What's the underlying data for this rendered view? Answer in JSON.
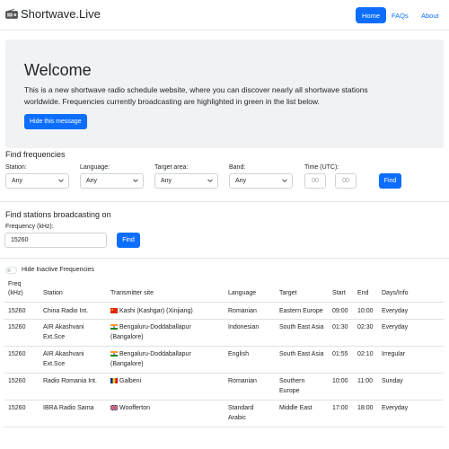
{
  "nav": {
    "brand": "Shortwave.Live",
    "home": "Home",
    "faqs": "FAQs",
    "about": "About"
  },
  "welcome": {
    "title": "Welcome",
    "text": "This is a new shortwave radio schedule website, where you can discover nearly all shortwave stations worldwide. Frequencies currently broadcasting are highlighted in green in the list below.",
    "button": "Hide this message"
  },
  "find_frequencies": {
    "title": "Find frequencies",
    "station_label": "Station:",
    "station_value": "Any",
    "language_label": "Language:",
    "language_value": "Any",
    "target_label": "Target area:",
    "target_value": "Any",
    "band_label": "Band:",
    "band_value": "Any",
    "time_label": "Time (UTC):",
    "time_hour_placeholder": "00",
    "time_min_placeholder": "00",
    "find_button": "Find"
  },
  "find_stations": {
    "title": "Find stations broadcasting on",
    "freq_label": "Frequency (kHz):",
    "freq_value": "15260",
    "find_button": "Find"
  },
  "toggle": {
    "label": "Hide Inactive Frequencies",
    "on": false
  },
  "table": {
    "headers": {
      "freq": "Freq",
      "freq_unit": "(kHz)",
      "station": "Station",
      "site": "Transmitter site",
      "language": "Language",
      "target": "Target",
      "start": "Start",
      "end": "End",
      "days": "Days/Info"
    },
    "rows": [
      {
        "freq": "15260",
        "station": [
          "China Radio Int."
        ],
        "flag": "china-flag-icon",
        "site": [
          "Kashi (Kashgar) (Xinjiang)"
        ],
        "language": [
          "Romanian"
        ],
        "target": [
          "Eastern Europe"
        ],
        "start": "09:00",
        "end": "10:00",
        "days": "Everyday"
      },
      {
        "freq": "15260",
        "station": [
          "AIR Akashvani",
          "Ext.Sce"
        ],
        "flag": "india-flag-icon",
        "site": [
          "Bengaluru-Doddaballapur",
          "(Bangalore)"
        ],
        "language": [
          "Indonesian"
        ],
        "target": [
          "South East Asia"
        ],
        "start": "01:30",
        "end": "02:30",
        "days": "Everyday"
      },
      {
        "freq": "15260",
        "station": [
          "AIR Akashvani",
          "Ext.Sce"
        ],
        "flag": "india-flag-icon",
        "site": [
          "Bengaluru-Doddaballapur",
          "(Bangalore)"
        ],
        "language": [
          "English"
        ],
        "target": [
          "South East Asia"
        ],
        "start": "01:55",
        "end": "02:10",
        "days": "Irregular"
      },
      {
        "freq": "15260",
        "station": [
          "Radio Romania Int."
        ],
        "flag": "romania-flag-icon",
        "site": [
          "Galbeni"
        ],
        "language": [
          "Romanian"
        ],
        "target": [
          "Southern",
          "Europe"
        ],
        "start": "10:00",
        "end": "11:00",
        "days": "Sunday"
      },
      {
        "freq": "15260",
        "station": [
          "IBRA Radio Sama"
        ],
        "flag": "uk-flag-icon",
        "site": [
          "Woofferton"
        ],
        "language": [
          "Standard",
          "Arabic"
        ],
        "target": [
          "Middle East"
        ],
        "start": "17:00",
        "end": "18:00",
        "days": "Everyday"
      }
    ]
  },
  "colors": {
    "accent": "#0d6efd",
    "jumbotron": "#f0f2f4",
    "divider": "#dee2e6"
  }
}
